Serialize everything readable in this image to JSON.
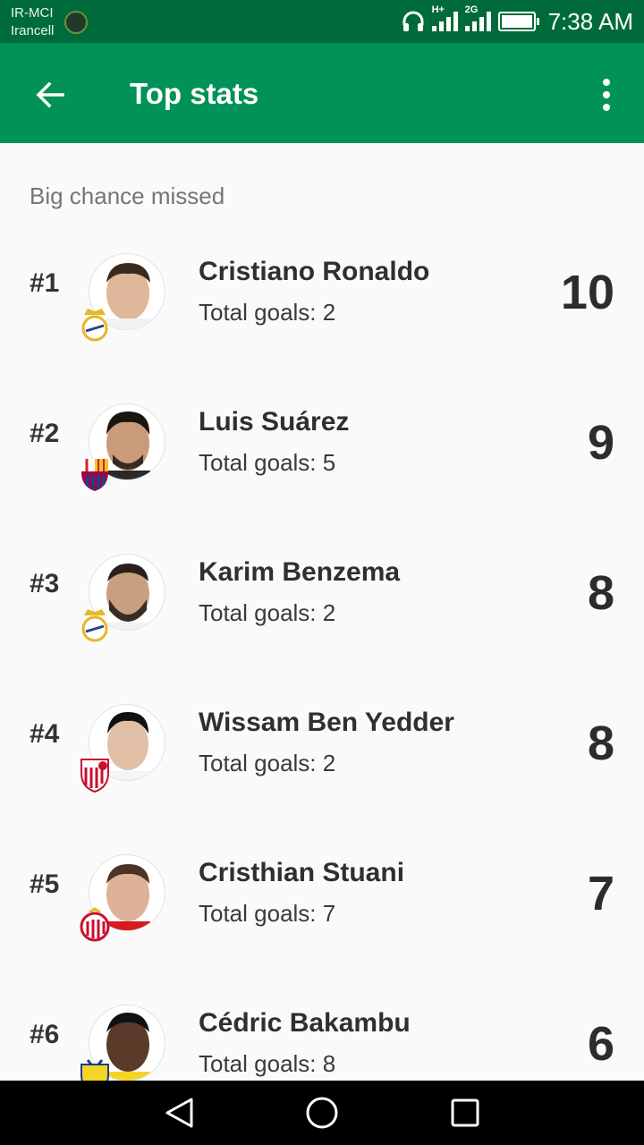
{
  "status": {
    "carrier_line1": "IR-MCI",
    "carrier_line2": "Irancell",
    "network_a": "H+",
    "network_b": "2G",
    "time": "7:38 AM"
  },
  "app_bar": {
    "title": "Top stats",
    "back_icon": "arrow-back-icon",
    "menu_icon": "more-vert-icon"
  },
  "section": {
    "title": "Big chance missed"
  },
  "players": [
    {
      "rank": "#1",
      "name": "Cristiano Ronaldo",
      "goals_text": "Total goals: 2",
      "value": "10",
      "club_badge": "real-madrid-badge"
    },
    {
      "rank": "#2",
      "name": "Luis Suárez",
      "goals_text": "Total goals: 5",
      "value": "9",
      "club_badge": "barcelona-badge"
    },
    {
      "rank": "#3",
      "name": "Karim Benzema",
      "goals_text": "Total goals: 2",
      "value": "8",
      "club_badge": "real-madrid-badge"
    },
    {
      "rank": "#4",
      "name": "Wissam Ben Yedder",
      "goals_text": "Total goals: 2",
      "value": "8",
      "club_badge": "sevilla-badge"
    },
    {
      "rank": "#5",
      "name": "Cristhian Stuani",
      "goals_text": "Total goals: 7",
      "value": "7",
      "club_badge": "girona-badge"
    },
    {
      "rank": "#6",
      "name": "Cédric Bakambu",
      "goals_text": "Total goals: 8",
      "value": "6",
      "club_badge": "villarreal-badge"
    }
  ],
  "nav": {
    "back": "nav-back-icon",
    "home": "nav-home-icon",
    "recents": "nav-recents-icon"
  },
  "colors": {
    "status_bar": "#006b3a",
    "app_bar": "#009257",
    "background": "#fafafa"
  }
}
